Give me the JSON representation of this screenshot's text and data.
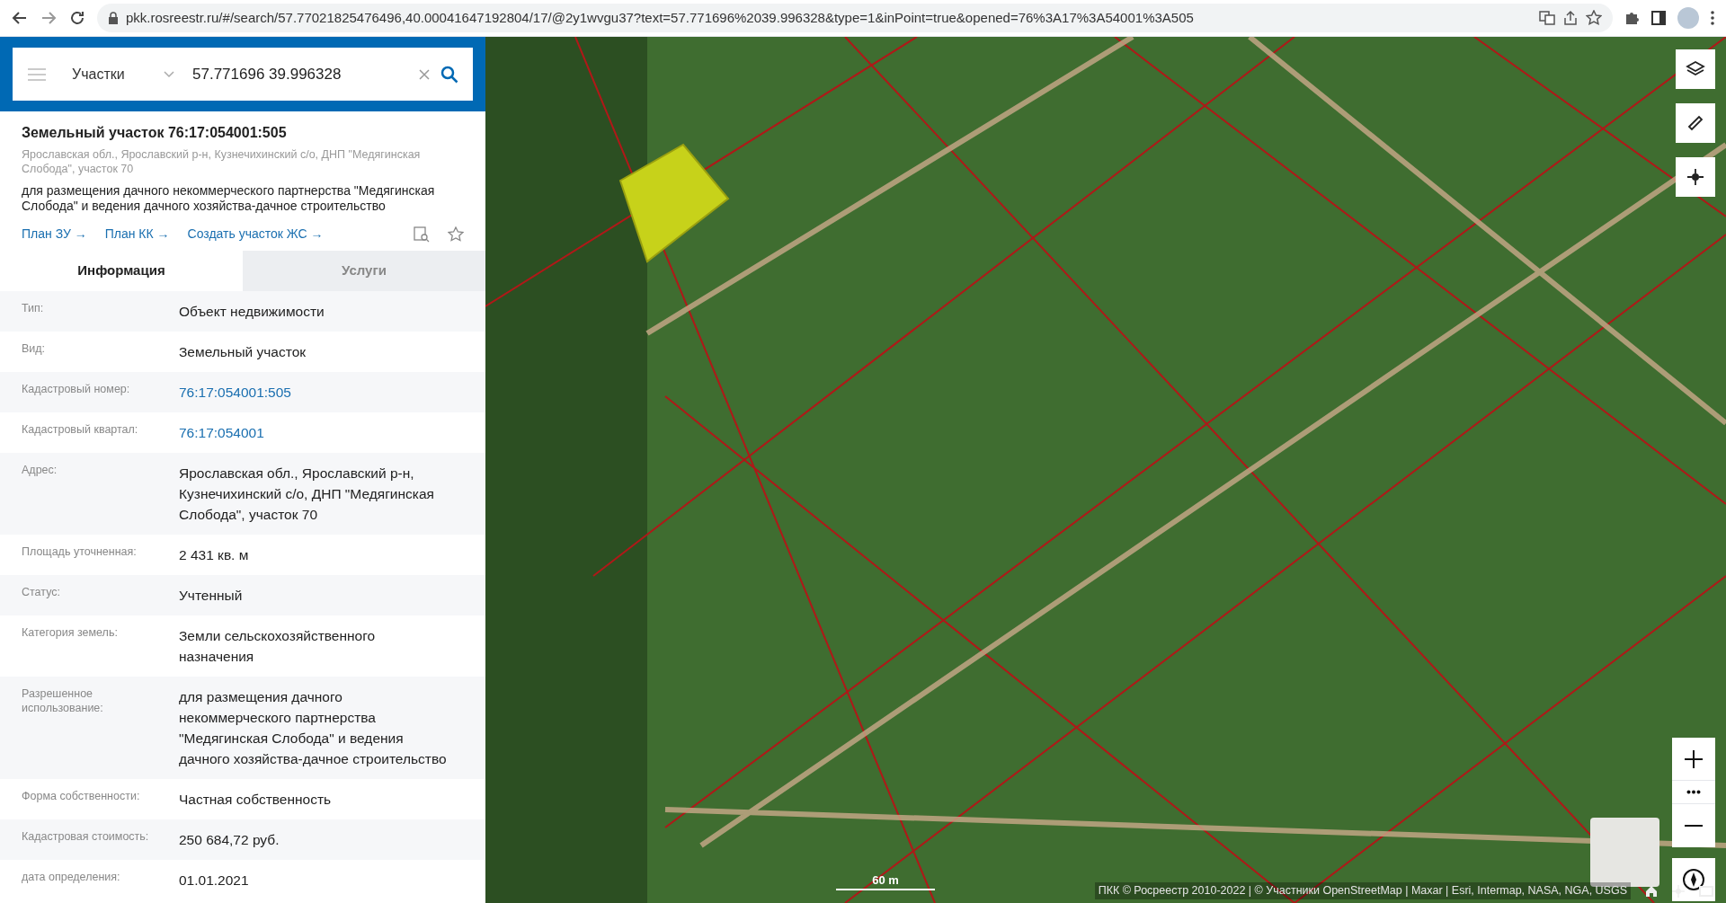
{
  "browser": {
    "url": "pkk.rosreestr.ru/#/search/57.77021825476496,40.00041647192804/17/@2y1wvgu37?text=57.771696%2039.996328&type=1&inPoint=true&opened=76%3A17%3A54001%3A505"
  },
  "search": {
    "category": "Участки",
    "value": "57.771696 39.996328"
  },
  "parcel": {
    "title": "Земельный участок 76:17:054001:505",
    "address": "Ярославская обл., Ярославский р-н, Кузнечихинский с/о, ДНП \"Медягинская Слобода\", участок 70",
    "usage": "для размещения дачного некоммерческого партнерства \"Медягинская Слобода\" и ведения дачного хозяйства-дачное строительство",
    "links": [
      "План ЗУ →",
      "План КК →",
      "Создать участок ЖС →"
    ]
  },
  "tabs": [
    {
      "label": "Информация",
      "selected": true
    },
    {
      "label": "Услуги",
      "selected": false
    }
  ],
  "rows": [
    {
      "label": "Тип:",
      "value": "Объект недвижимости",
      "kind": "text"
    },
    {
      "label": "Вид:",
      "value": "Земельный участок",
      "kind": "text"
    },
    {
      "label": "Кадастровый номер:",
      "value": "76:17:054001:505",
      "kind": "link"
    },
    {
      "label": "Кадастровый квартал:",
      "value": "76:17:054001",
      "kind": "link"
    },
    {
      "label": "Адрес:",
      "value": "Ярославская обл., Ярославский р-н, Кузнечихинский с/о, ДНП \"Медягинская Слобода\", участок 70",
      "kind": "text"
    },
    {
      "label": "Площадь уточненная:",
      "value": "2 431 кв. м",
      "kind": "text"
    },
    {
      "label": "Статус:",
      "value": "Учтенный",
      "kind": "text"
    },
    {
      "label": "Категория земель:",
      "value": "Земли сельскохозяйственного назначения",
      "kind": "text"
    },
    {
      "label": "Разрешенное использование:",
      "value": "для размещения дачного некоммерческого партнерства \"Медягинская Слобода\" и ведения дачного хозяйства-дачное строительство",
      "kind": "text"
    },
    {
      "label": "Форма собственности:",
      "value": "Частная собственность",
      "kind": "text"
    },
    {
      "label": "Кадастровая стоимость:",
      "value": "250 684,72 руб.",
      "kind": "text"
    },
    {
      "label": "дата определения:",
      "value": "01.01.2021",
      "kind": "text"
    }
  ],
  "map": {
    "scale": "60 m",
    "attribution": "ПКК © Росреестр 2010-2022 | © Участники OpenStreetMap | Maxar | Esri, Intermap, NASA, NGA, USGS"
  }
}
